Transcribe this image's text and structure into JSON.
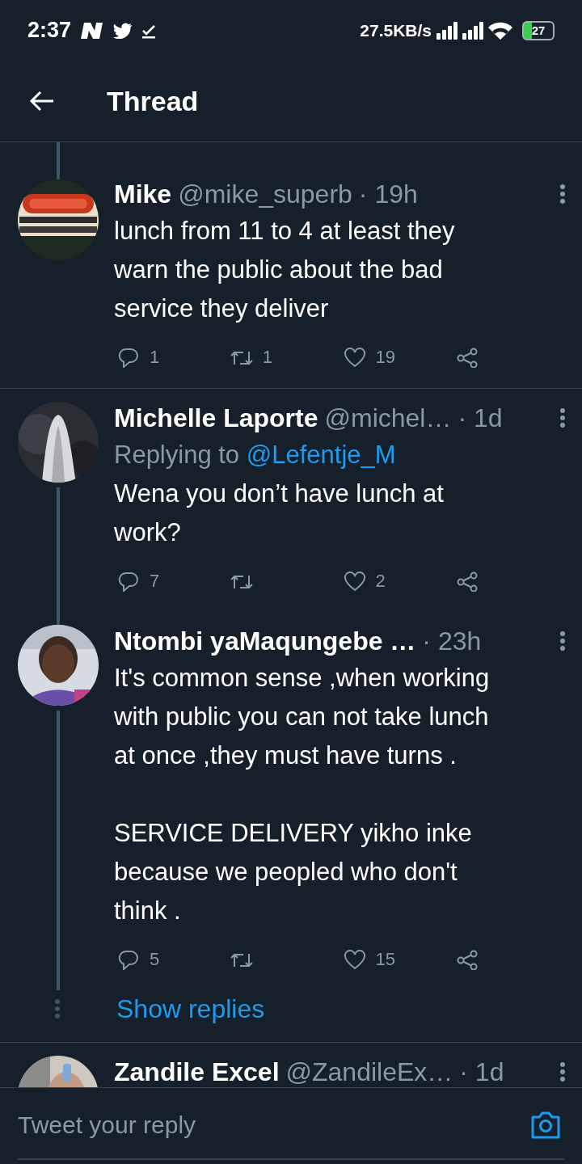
{
  "status_bar": {
    "time": "2:37",
    "speed": "27.5KB/s",
    "battery": "27"
  },
  "header": {
    "title": "Thread"
  },
  "tweets": [
    {
      "name": "Mike",
      "handle": "@mike_superb",
      "time": "· 19h",
      "text": "lunch from 11 to 4 at least they\nwarn the public about the bad\nservice they deliver",
      "replies": "1",
      "retweets": "1",
      "likes": "19",
      "connected_above": true,
      "connected_below": false
    },
    {
      "name": "Michelle Laporte",
      "handle": "@michel…",
      "time": "· 1d",
      "replying_label": "Replying to",
      "replying_handle": "@Lefentje_M",
      "text": "Wena you don’t have lunch at\nwork?",
      "replies": "7",
      "likes": "2",
      "connected_above": false,
      "connected_below": true
    },
    {
      "name": "Ntombi yaMaqungebe …",
      "time": "· 23h",
      "text": "It's common sense ,when working\nwith public you can not take lunch\nat once ,they must have turns .\n\nSERVICE DELIVERY yikho inke\nbecause we peopled who don't\nthink .",
      "replies": "5",
      "likes": "15",
      "connected_above": true,
      "connected_below": true,
      "show_replies": "Show replies"
    },
    {
      "name": "Zandile Excel",
      "handle": "@ZandileEx…",
      "time": "· 1d",
      "connected_above": false,
      "connected_below": false
    }
  ],
  "reply_bar": {
    "placeholder": "Tweet your reply"
  }
}
